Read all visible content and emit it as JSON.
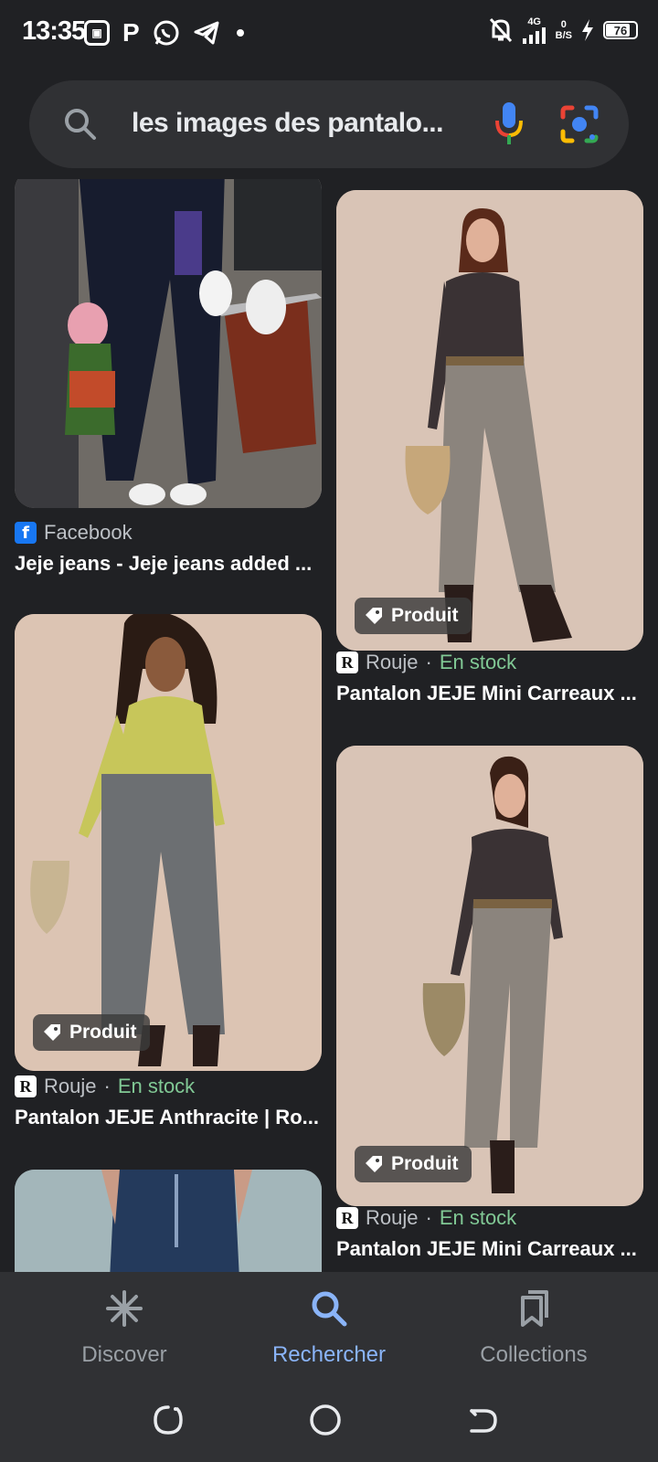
{
  "status_bar": {
    "time": "13:35",
    "network": "4G",
    "speed_value": "0",
    "speed_unit": "B/S",
    "battery": "76"
  },
  "search": {
    "query": "les images des pantalo..."
  },
  "results": [
    {
      "source": "Facebook",
      "source_icon": "facebook-icon",
      "title": "Jeje jeans - Jeje jeans added ...",
      "stock": "",
      "badge": ""
    },
    {
      "source": "Rouje",
      "source_icon": "rouje-icon",
      "stock": "En stock",
      "title": "Pantalon JEJE Mini Carreaux ...",
      "badge": "Produit"
    },
    {
      "source": "Rouje",
      "source_icon": "rouje-icon",
      "stock": "En stock",
      "title": "Pantalon JEJE Anthracite | Ro...",
      "badge": "Produit"
    },
    {
      "source": "Rouje",
      "source_icon": "rouje-icon",
      "stock": "En stock",
      "title": "Pantalon JEJE Mini Carreaux ...",
      "badge": "Produit"
    },
    {
      "source": "",
      "title": "",
      "badge": ""
    }
  ],
  "separator": "·",
  "bottom_nav": {
    "items": [
      {
        "label": "Discover",
        "icon": "asterisk-icon"
      },
      {
        "label": "Rechercher",
        "icon": "search-icon"
      },
      {
        "label": "Collections",
        "icon": "collections-icon"
      }
    ],
    "active": "Rechercher"
  },
  "colors": {
    "background": "#202124",
    "surface": "#303134",
    "accent": "#8ab4f8",
    "in_stock": "#81c995"
  }
}
